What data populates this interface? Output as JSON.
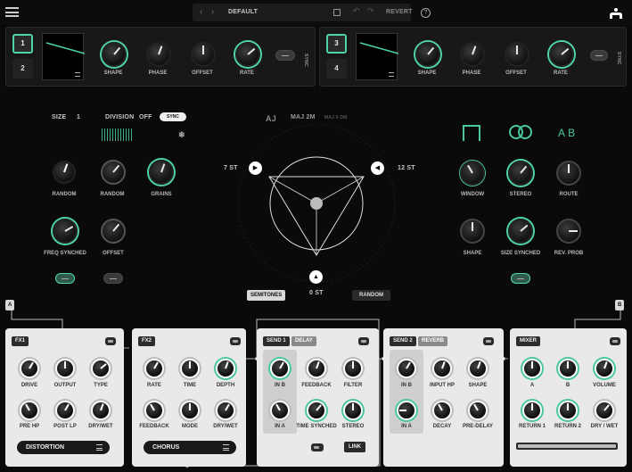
{
  "topbar": {
    "preset": "DEFAULT",
    "revert": "REVERT",
    "help": "?"
  },
  "lfo1": {
    "slots": [
      "1",
      "2"
    ],
    "labels": [
      "SHAPE",
      "PHASE",
      "OFFSET",
      "RATE"
    ],
    "sync": "SYNC"
  },
  "lfo2": {
    "slots": [
      "3",
      "4"
    ],
    "labels": [
      "SHAPE",
      "PHASE",
      "OFFSET",
      "RATE"
    ],
    "sync": "SYNC"
  },
  "grain": {
    "size_label": "SIZE",
    "size_value": "1",
    "division_label": "DIVISION",
    "division_value": "OFF",
    "sync": "SYNC",
    "k1": "RANDOM",
    "k2": "RANDOM",
    "k3": "GRAINS",
    "k4": "FREQ SYNCHED",
    "k5": "OFFSET"
  },
  "pitch": {
    "scale": "AJ",
    "chord": "MAJ 2M",
    "chord2": "MAJ 5 DM",
    "left": "7 ST",
    "right": "12 ST",
    "bottom": "0 ST",
    "semitones": "SEMITONES",
    "random": "RANDOM"
  },
  "right": {
    "ab": "A B",
    "k1": "WINDOW",
    "k2": "STEREO",
    "k3": "ROUTE",
    "k4": "SHAPE",
    "k5": "SIZE SYNCHED",
    "k6": "REV. PROB"
  },
  "markers": {
    "a": "A",
    "b": "B"
  },
  "fx1": {
    "title": "FX1",
    "labels": [
      "DRIVE",
      "OUTPUT",
      "TYPE",
      "PRE HP",
      "POST LP",
      "DRY/WET"
    ],
    "effect": "DISTORTION"
  },
  "fx2": {
    "title": "FX2",
    "labels": [
      "RATE",
      "TIME",
      "DEPTH",
      "FEEDBACK",
      "MODE",
      "DRY/WET"
    ],
    "effect": "CHORUS"
  },
  "send1": {
    "title": "SEND 1",
    "type": "DELAY",
    "labels": [
      "IN B",
      "FEEDBACK",
      "FILTER",
      "IN A",
      "TIME SYNCHED",
      "STEREO"
    ],
    "link": "LINK"
  },
  "send2": {
    "title": "SEND 2",
    "type": "REVERB",
    "labels": [
      "IN B",
      "INPUT HP",
      "SHAPE",
      "IN A",
      "DECAY",
      "PRE-DELAY"
    ]
  },
  "mixer": {
    "title": "MIXER",
    "labels": [
      "A",
      "B",
      "VOLUME",
      "RETURN 1",
      "RETURN 2",
      "DRY / WET"
    ]
  }
}
